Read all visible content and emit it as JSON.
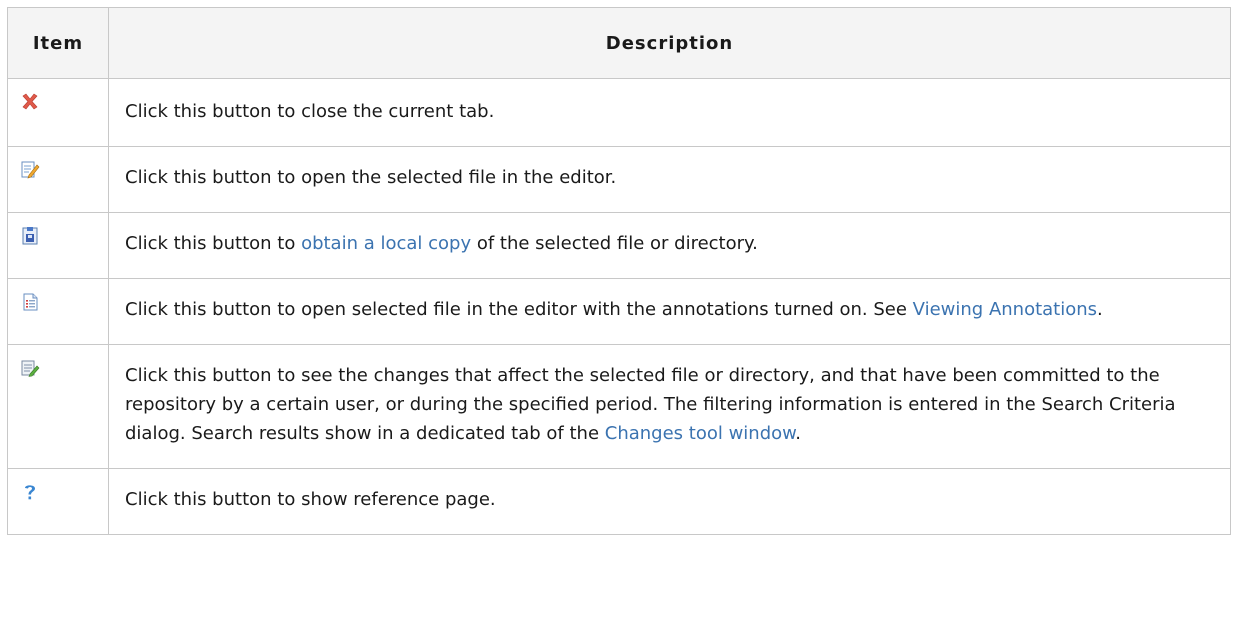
{
  "table": {
    "headers": {
      "item": "Item",
      "description": "Description"
    },
    "rows": [
      {
        "icon": "close-icon",
        "parts": [
          {
            "text": "Click this button to close the current tab."
          }
        ]
      },
      {
        "icon": "edit-icon",
        "parts": [
          {
            "text": "Click this button to open the selected file in the editor."
          }
        ]
      },
      {
        "icon": "checkout-icon",
        "parts": [
          {
            "text": "Click this button to "
          },
          {
            "text": "obtain a local copy",
            "link": true
          },
          {
            "text": " of the selected file or directory."
          }
        ]
      },
      {
        "icon": "annotate-icon",
        "parts": [
          {
            "text": "Click this button to open selected file in the editor with the annotations turned on. See "
          },
          {
            "text": "Viewing Annotations",
            "link": true
          },
          {
            "text": "."
          }
        ]
      },
      {
        "icon": "browse-changes-icon",
        "parts": [
          {
            "text": "Click this button to see the changes that affect the selected file or directory, and that have been committed to the repository by a certain user, or during the specified period. The filtering information is entered in the Search Criteria dialog. Search results show in a dedicated tab of the "
          },
          {
            "text": "Changes tool window",
            "link": true
          },
          {
            "text": "."
          }
        ]
      },
      {
        "icon": "help-icon",
        "parts": [
          {
            "text": "Click this button to show reference page."
          }
        ]
      }
    ]
  },
  "colors": {
    "link": "#3b73b0",
    "border": "#c8c8c8",
    "header_bg": "#f4f4f4",
    "close_red": "#e05a4a",
    "help_blue": "#3a86d1"
  }
}
